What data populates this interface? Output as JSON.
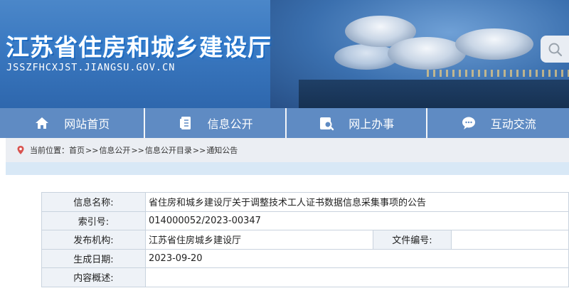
{
  "header": {
    "site_title": "江苏省住房和城乡建设厅",
    "site_domain": "JSSZFHCXJST.JIANGSU.GOV.CN"
  },
  "nav": {
    "items": [
      {
        "label": "网站首页",
        "icon": "home-icon"
      },
      {
        "label": "信息公开",
        "icon": "document-icon"
      },
      {
        "label": "网上办事",
        "icon": "service-search-icon"
      },
      {
        "label": "互动交流",
        "icon": "chat-icon"
      }
    ]
  },
  "breadcrumb": {
    "prefix": "当前位置：",
    "items": [
      "首页",
      "信息公开",
      "信息公开目录",
      "通知公告"
    ],
    "separator": ">>"
  },
  "info_table": {
    "name_label": "信息名称:",
    "name_value": "省住房和城乡建设厅关于调整技术工人证书数据信息采集事项的公告",
    "index_label": "索引号:",
    "index_value": "014000052/2023-00347",
    "publisher_label": "发布机构:",
    "publisher_value": "江苏省住房城乡建设厅",
    "docno_label": "文件编号:",
    "docno_value": "",
    "date_label": "生成日期:",
    "date_value": "2023-09-20",
    "summary_label": "内容概述:",
    "summary_value": ""
  },
  "colors": {
    "nav_bg": "#5f8bc3",
    "banner_bg": "#3a78c0",
    "label_bg": "#eef2f7"
  }
}
